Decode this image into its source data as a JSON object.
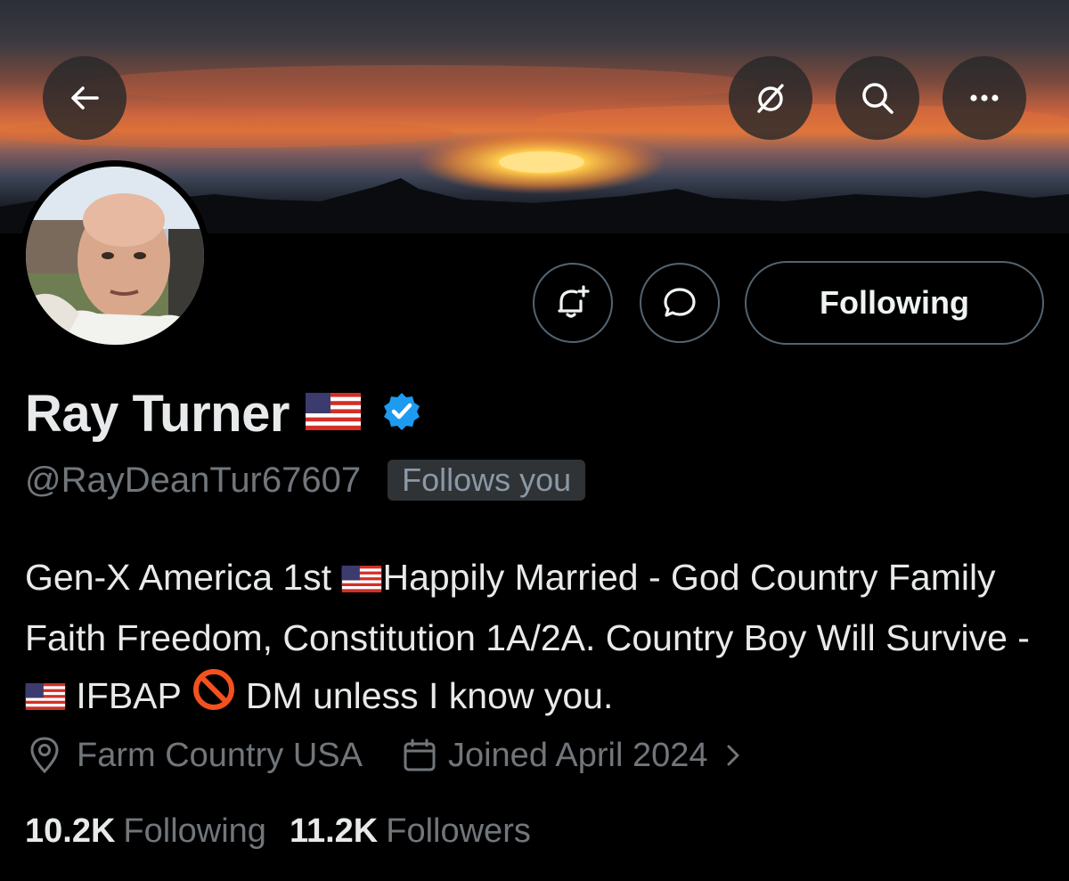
{
  "profile": {
    "name": "Ray Turner",
    "handle": "@RayDeanTur67607",
    "follows_you": "Follows you",
    "bio": {
      "part1": "Gen-X America 1st ",
      "part2": "Happily Married - God Country Family Faith Freedom, Constitution 1A/2A. Country Boy Will Survive - ",
      "part3": " IFBAP ",
      "part4": " DM unless I know you."
    },
    "location": "Farm Country USA",
    "joined": "Joined April 2024",
    "following_count": "10.2K",
    "following_label": "Following",
    "followers_count": "11.2K",
    "followers_label": "Followers",
    "verified": true
  },
  "actions": {
    "following_button": "Following"
  },
  "icons": {
    "back": "arrow-left-icon",
    "grok": "grok-icon",
    "search": "search-icon",
    "more": "more-icon",
    "notify": "bell-plus-icon",
    "message": "message-icon",
    "location": "location-pin-icon",
    "calendar": "calendar-icon",
    "chevron": "chevron-right-icon",
    "verified": "verified-badge-icon",
    "flag": "us-flag-emoji",
    "prohibited": "prohibited-emoji"
  },
  "colors": {
    "background": "#000000",
    "text": "#e7e9ea",
    "muted": "#71767b",
    "verified": "#1d9bf0",
    "border": "#536471"
  }
}
